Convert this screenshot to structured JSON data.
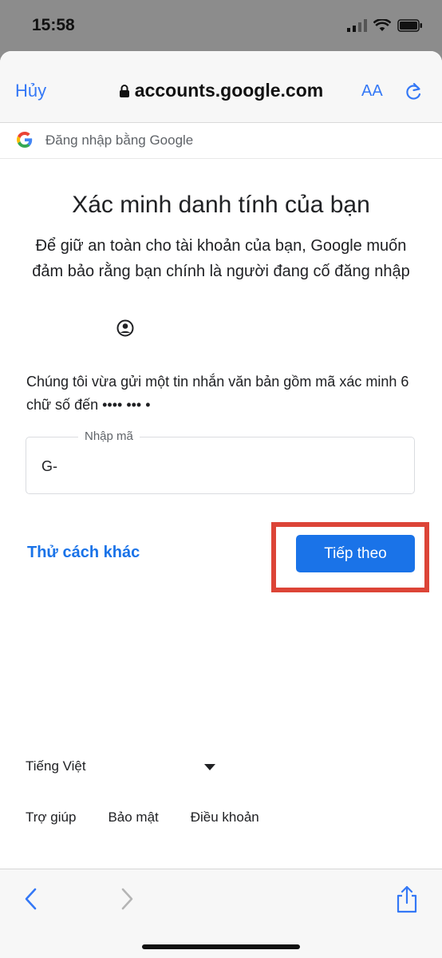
{
  "status_bar": {
    "time": "15:58"
  },
  "browser": {
    "cancel_label": "Hủy",
    "url": "accounts.google.com",
    "text_size_label": "AA"
  },
  "google_bar": {
    "label": "Đăng nhập bằng Google"
  },
  "verify": {
    "title": "Xác minh danh tính của bạn",
    "subtitle": "Để giữ an toàn cho tài khoản của bạn, Google muốn đảm bảo rằng bạn chính là người đang cố đăng nhập",
    "instruction": "Chúng tôi vừa gửi một tin nhắn văn bản gồm mã xác minh 6 chữ số đến •••• ••• •",
    "code_label": "Nhập mã",
    "code_value": "G-",
    "try_another_label": "Thử cách khác",
    "next_label": "Tiếp theo"
  },
  "footer": {
    "language": "Tiếng Việt",
    "links": [
      "Trợ giúp",
      "Bảo mật",
      "Điều khoản"
    ]
  },
  "colors": {
    "accent": "#1a73e8",
    "ios_blue": "#3478f6",
    "highlight": "#dc4437"
  }
}
